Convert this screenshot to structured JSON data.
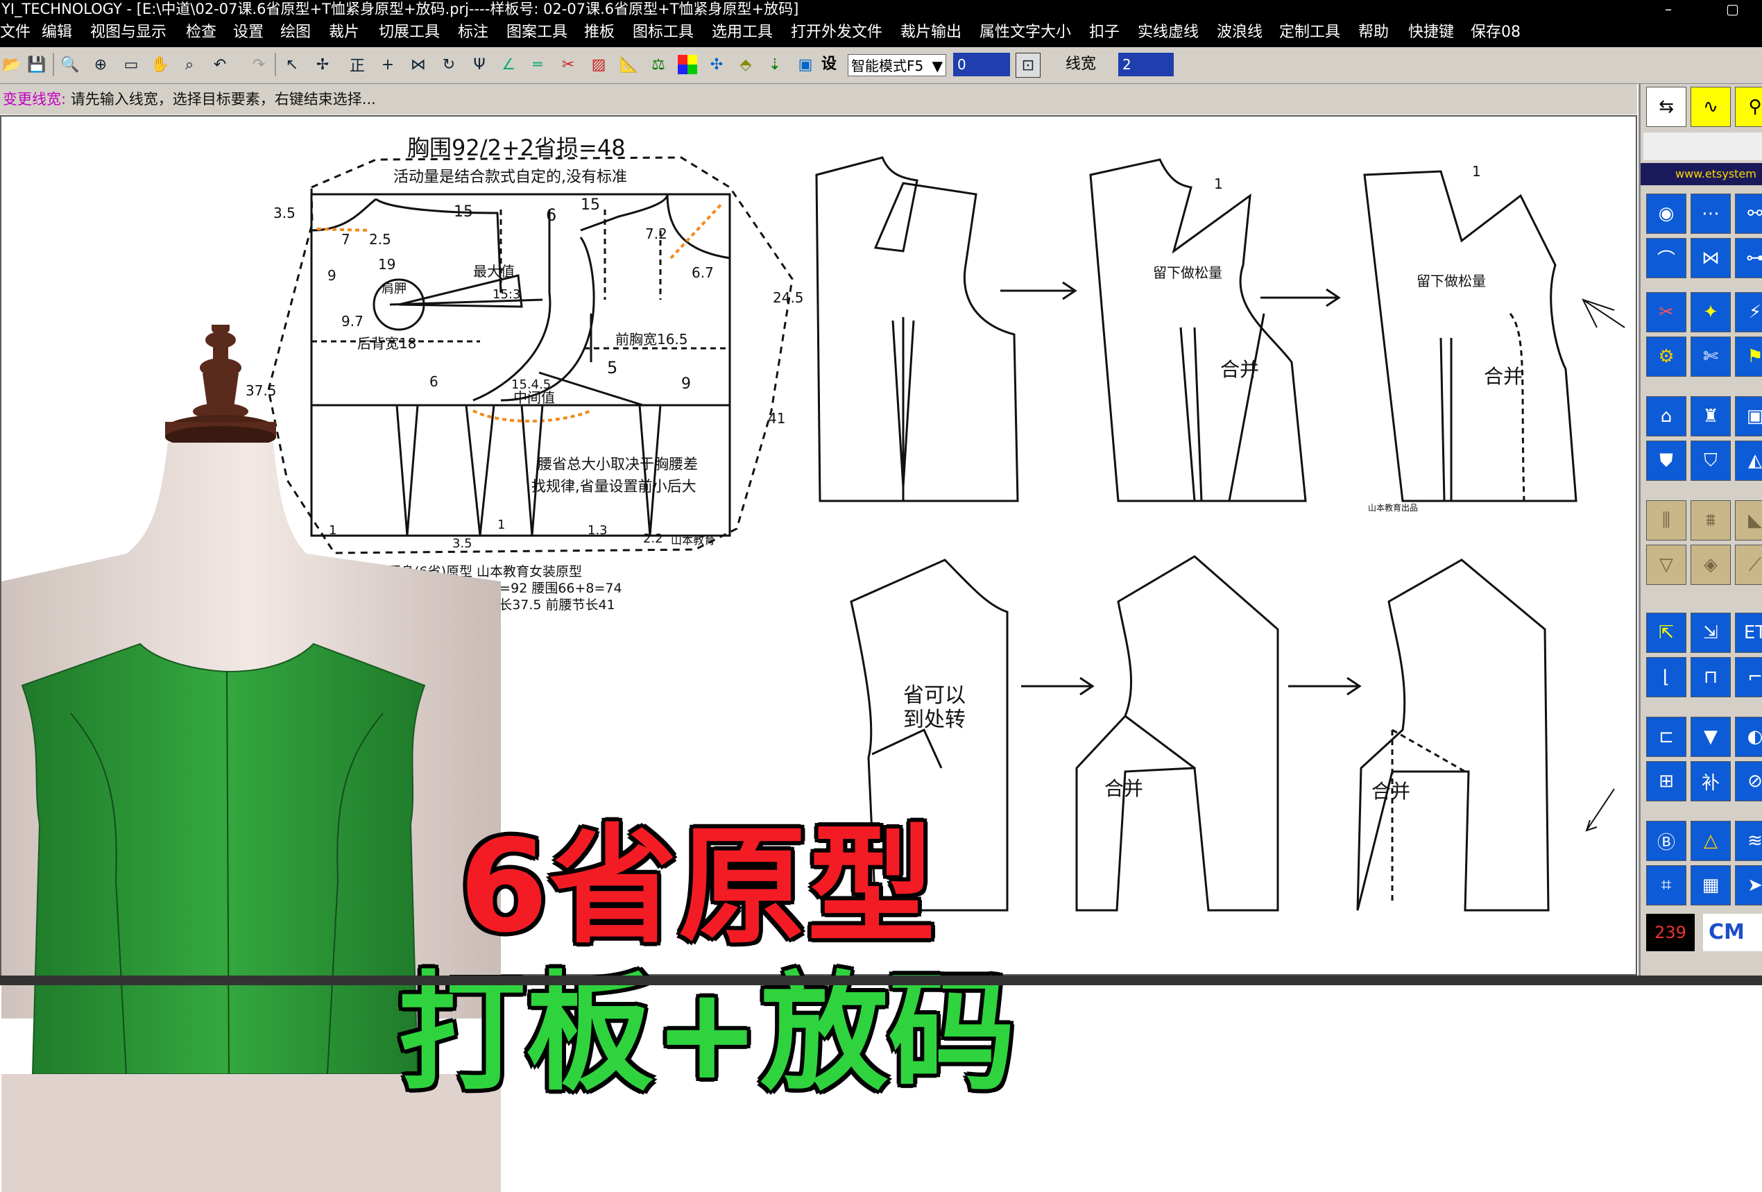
{
  "window": {
    "title": "YI_TECHNOLOGY - [E:\\中道\\02-07课.6省原型+T恤紧身原型+放码.prj----样板号: 02-07课.6省原型+T恤紧身原型+放码]"
  },
  "menu": [
    "文件",
    "编辑",
    "视图与显示",
    "检查",
    "设置",
    "绘图",
    "裁片",
    "切展工具",
    "标注",
    "图案工具",
    "推板",
    "图标工具",
    "选用工具",
    "打开外发文件",
    "裁片输出",
    "属性文字大小",
    "扣子",
    "实线虚线",
    "波浪线",
    "定制工具",
    "帮助",
    "快捷键",
    "保存08"
  ],
  "toolbar": {
    "set_label": "设",
    "mode_value": "智能模式F5",
    "field1_value": "0",
    "line_width_label": "线宽",
    "line_width_value": "2"
  },
  "status": {
    "command": "变更线宽:",
    "hint": "请先输入线宽，选择目标要素，右键结束选择..."
  },
  "right_panel": {
    "website": "www.etsystem",
    "counter": "239",
    "brand": "CM"
  },
  "drawing": {
    "title": "胸围92/2+2省损=48",
    "subtitle": "活动量是结合款式自定的,没有标准",
    "shoulder_label": "肩胛",
    "max_label": "最大值",
    "max_value": "15:3",
    "back_width": "后背宽18",
    "front_chest_width": "前胸宽16.5",
    "middle_label": "中间值",
    "middle_value": "15.4.5",
    "waist_note_1": "腰省总大小取决于胸腰差",
    "waist_note_2": "找规律,省量设置前小后大",
    "stamp": "山本教育",
    "caption_1": "6开身(6省)原型 山本教育女装原型",
    "caption_2": "胸围84+8松量=92   腰围66+8=74",
    "caption_3": "背长37   背长37.5   前腰节长41",
    "dims": {
      "d35": "3.5",
      "d15a": "15",
      "d6": "6",
      "d15b": "15",
      "d7": "7",
      "d25": "2.5",
      "d72": "7.2",
      "d19": "19",
      "d9a": "9",
      "d67": "6.7",
      "d97": "9.7",
      "d245": "24.5",
      "d375": "37.5",
      "d6b": "6",
      "d5": "5",
      "d9b": "9",
      "d41": "41",
      "d1a": "1",
      "d35b": "3.5",
      "d1b": "1",
      "d13": "1.3",
      "d22": "2.2"
    },
    "pattern_labels": {
      "keep_ease_1": "留下做松量",
      "keep_ease_2": "留下做松量",
      "merge_1": "合并",
      "merge_2": "合并",
      "merge_3": "合并",
      "merge_4": "合并",
      "dart_note_1": "省可以",
      "dart_note_2": "到处转",
      "num_1a": "1",
      "num_1b": "1",
      "stamp_small": "山本教育出品"
    }
  },
  "headline": {
    "line1": "6省原型",
    "line2": "打板+放码"
  },
  "colors": {
    "garment": "#2e9e3a",
    "headline_red": "#f31c25",
    "headline_green": "#2fd33e",
    "dress_form": "#e9dcd8",
    "finial": "#5a2a1c"
  }
}
